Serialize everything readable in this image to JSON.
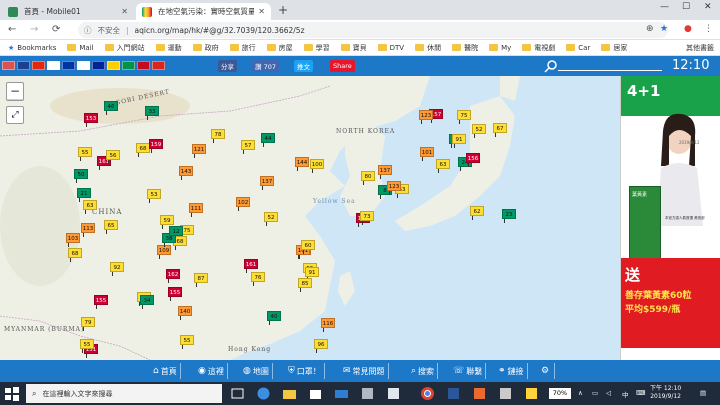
{
  "browser": {
    "tabs": [
      {
        "label": "首頁 - Mobile01",
        "active": false
      },
      {
        "label": "在地空氣污染：實時空氣質量指數",
        "active": true
      }
    ],
    "new_tab": "+",
    "nav": {
      "back": "←",
      "forward": "→",
      "reload": "C"
    },
    "address": {
      "security": "不安全",
      "url": "aqicn.org/map/hk/#@g/32.7039/120.3662/5z"
    },
    "bookmarks": [
      {
        "label": "Bookmarks",
        "type": "star"
      },
      {
        "label": "Mail",
        "type": "folder"
      },
      {
        "label": "入門網站",
        "type": "folder"
      },
      {
        "label": "運動",
        "type": "folder"
      },
      {
        "label": "政府",
        "type": "folder"
      },
      {
        "label": "旅行",
        "type": "folder"
      },
      {
        "label": "房屋",
        "type": "folder"
      },
      {
        "label": "學習",
        "type": "folder"
      },
      {
        "label": "寶貝",
        "type": "folder"
      },
      {
        "label": "DTV",
        "type": "folder"
      },
      {
        "label": "休閒",
        "type": "folder"
      },
      {
        "label": "醫院",
        "type": "folder"
      },
      {
        "label": "My",
        "type": "folder"
      },
      {
        "label": "電視劇",
        "type": "folder"
      },
      {
        "label": "Car",
        "type": "folder"
      },
      {
        "label": "居家",
        "type": "folder"
      }
    ],
    "bookmarks_other": "其他書籤"
  },
  "site": {
    "share_fb": "分享",
    "share_like": "讚 707",
    "share_tw": "推文",
    "share_wb": "Share",
    "clock": "12:10",
    "flag_colors": [
      "#d9534f",
      "#1f3f8f",
      "#de2910",
      "#ffffff",
      "#0033a0",
      "#ffffff",
      "#002395",
      "#ffce00",
      "#009246",
      "#c60b1e",
      "#da251d"
    ]
  },
  "map": {
    "labels": [
      {
        "text": "GOBI DESERT"
      },
      {
        "text": "CHINA"
      },
      {
        "text": "NORTH KOREA"
      },
      {
        "text": "Yellow Sea"
      },
      {
        "text": "MYANMAR (BURMA)"
      },
      {
        "text": "Hong Kong"
      }
    ],
    "zoom_in": "+",
    "zoom_out": "−",
    "fullscreen": "⤢",
    "aqi_scale": {
      "good": "#009966",
      "moderate": "#ffde33",
      "sensitive": "#ff9933",
      "unhealthy": "#cc0033",
      "very_unhealthy": "#660099"
    },
    "stations": [
      {
        "v": "78"
      },
      {
        "v": "75"
      },
      {
        "v": "108"
      },
      {
        "v": "89"
      },
      {
        "v": "113"
      },
      {
        "v": "57"
      },
      {
        "v": "121"
      },
      {
        "v": "96"
      },
      {
        "v": "55"
      },
      {
        "v": "68"
      },
      {
        "v": "68"
      },
      {
        "v": "45"
      },
      {
        "v": "159"
      },
      {
        "v": "80"
      },
      {
        "v": "100"
      },
      {
        "v": "91"
      },
      {
        "v": "155"
      },
      {
        "v": "161"
      },
      {
        "v": "153"
      },
      {
        "v": "161"
      },
      {
        "v": "63"
      },
      {
        "v": "140"
      },
      {
        "v": "143"
      },
      {
        "v": "44"
      },
      {
        "v": "40"
      },
      {
        "v": "23"
      },
      {
        "v": "8"
      },
      {
        "v": "53"
      },
      {
        "v": "162"
      },
      {
        "v": "164"
      },
      {
        "v": "109"
      },
      {
        "v": "151"
      },
      {
        "v": "101"
      },
      {
        "v": "155"
      },
      {
        "v": "157"
      },
      {
        "v": "76"
      },
      {
        "v": "144"
      },
      {
        "v": "123"
      },
      {
        "v": "103"
      },
      {
        "v": "67"
      },
      {
        "v": "50"
      },
      {
        "v": "21"
      },
      {
        "v": "34"
      },
      {
        "v": "46"
      },
      {
        "v": "63"
      },
      {
        "v": "111"
      },
      {
        "v": "52"
      },
      {
        "v": "73"
      },
      {
        "v": "137"
      },
      {
        "v": "79"
      },
      {
        "v": "55"
      },
      {
        "v": "68"
      },
      {
        "v": "36"
      },
      {
        "v": "24"
      },
      {
        "v": "55"
      },
      {
        "v": "91"
      },
      {
        "v": "116"
      },
      {
        "v": "87"
      },
      {
        "v": "63"
      },
      {
        "v": "62"
      },
      {
        "v": "55"
      },
      {
        "v": "102"
      },
      {
        "v": "123"
      },
      {
        "v": "85"
      },
      {
        "v": "59"
      },
      {
        "v": "52"
      },
      {
        "v": "56"
      },
      {
        "v": "33"
      },
      {
        "v": "75"
      },
      {
        "v": "92"
      },
      {
        "v": "137"
      },
      {
        "v": "156"
      },
      {
        "v": "101"
      },
      {
        "v": "60"
      },
      {
        "v": "65"
      },
      {
        "v": "12"
      }
    ]
  },
  "ad": {
    "badge": "4+1",
    "date": "2019/9/12",
    "box_label": "葉黃素",
    "desc": "本官方認人氣首選 黃斑部",
    "send": "送",
    "promo1": "善存葉黃素60粒",
    "promo2": "平均$599/瓶"
  },
  "bottom_nav": [
    {
      "label": "首頁",
      "icon": "home-icon"
    },
    {
      "label": "這裡",
      "icon": "location-icon"
    },
    {
      "label": "地圖",
      "icon": "globe-icon"
    },
    {
      "label": "口罩！",
      "icon": "mask-icon"
    },
    {
      "label": "常見問題",
      "icon": "chat-icon"
    },
    {
      "label": "搜索",
      "icon": "search-icon"
    },
    {
      "label": "聯繫",
      "icon": "contact-icon"
    },
    {
      "label": "鏈接",
      "icon": "link-icon"
    },
    {
      "label": "",
      "icon": "gear-icon"
    }
  ],
  "taskbar": {
    "search_placeholder": "在這裡輸入文字來搜尋",
    "zoom": "70%",
    "time": "下午 12:10",
    "date": "2019/9/12"
  }
}
